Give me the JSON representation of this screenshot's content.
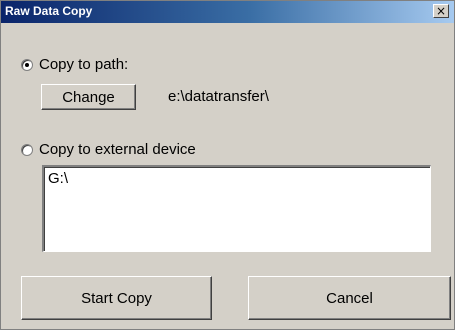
{
  "window": {
    "title": "Raw Data Copy",
    "close_glyph": "×"
  },
  "copy_to_path": {
    "label": "Copy to path:",
    "selected": true,
    "change_button": "Change",
    "path": "e:\\datatransfer\\"
  },
  "copy_to_device": {
    "label": "Copy to external device",
    "selected": false,
    "value": "G:\\"
  },
  "buttons": {
    "start": "Start Copy",
    "cancel": "Cancel"
  },
  "colors": {
    "titlebar_start": "#0a246a",
    "titlebar_end": "#a6caf0",
    "face": "#d4d0c8"
  }
}
